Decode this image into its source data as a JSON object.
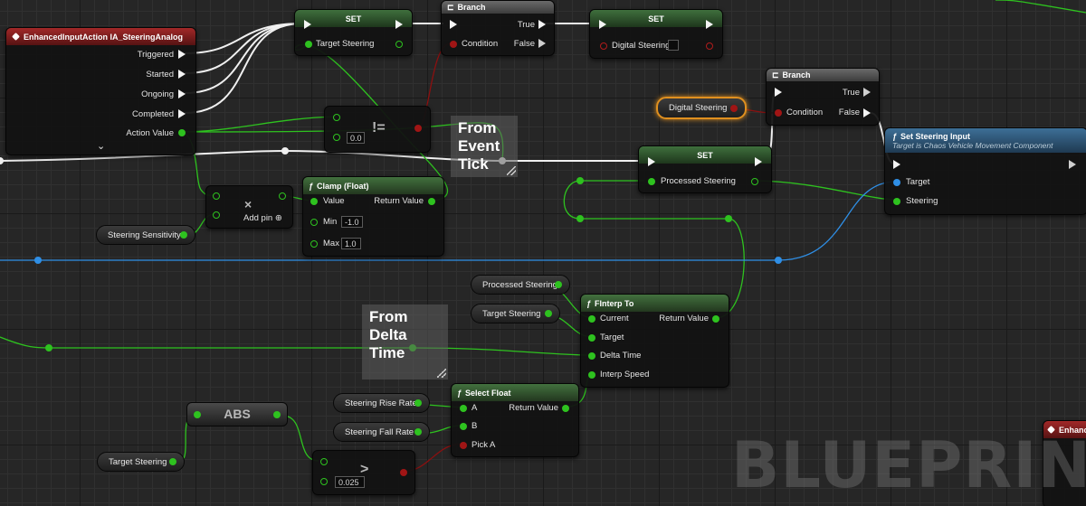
{
  "watermark": "BLUEPRINT",
  "nodes": {
    "input_action": {
      "title": "EnhancedInputAction IA_SteeringAnalog",
      "pins": [
        "Triggered",
        "Started",
        "Ongoing",
        "Completed",
        "Action Value"
      ],
      "expand": "⌄"
    },
    "input_action_offscreen": {
      "title": "Enhanc"
    },
    "set_target": {
      "title": "SET",
      "pin": "Target Steering"
    },
    "branch1": {
      "title": "Branch",
      "true_label": "True",
      "false_label": "False",
      "condition_label": "Condition"
    },
    "set_digital": {
      "title": "SET",
      "pin": "Digital Steering"
    },
    "branch2": {
      "title": "Branch",
      "true_label": "True",
      "false_label": "False",
      "condition_label": "Condition"
    },
    "digital_steering_var": {
      "label": "Digital Steering"
    },
    "not_equal": {
      "value": "0.0",
      "op": "!="
    },
    "set_steering_input": {
      "title": "Set Steering Input",
      "subtitle": "Target is Chaos Vehicle Movement Component",
      "target_label": "Target",
      "steering_label": "Steering"
    },
    "set_processed": {
      "title": "SET",
      "pin": "Processed Steering"
    },
    "multiply": {
      "op": "×",
      "add_pin": "Add pin"
    },
    "clamp": {
      "title": "Clamp (Float)",
      "value_label": "Value",
      "return_label": "Return Value",
      "min_label": "Min",
      "min_value": "-1.0",
      "max_label": "Max",
      "max_value": "1.0"
    },
    "steering_sensitivity": {
      "label": "Steering Sensitivity"
    },
    "processed_steering_var": {
      "label": "Processed Steering"
    },
    "target_steering_var": {
      "label": "Target Steering"
    },
    "finterp": {
      "title": "FInterp To",
      "current_label": "Current",
      "target_label": "Target",
      "delta_label": "Delta Time",
      "speed_label": "Interp Speed",
      "return_label": "Return Value"
    },
    "select_float": {
      "title": "Select Float",
      "a_label": "A",
      "b_label": "B",
      "pick_label": "Pick A",
      "return_label": "Return Value"
    },
    "rise_rate": {
      "label": "Steering Rise Rate"
    },
    "fall_rate": {
      "label": "Steering Fall Rate"
    },
    "abs": {
      "label": "ABS"
    },
    "target_steering_var2": {
      "label": "Target Steering"
    },
    "greater": {
      "value": "0.025",
      "op": ">"
    }
  },
  "comments": {
    "event_tick": "From Event Tick",
    "delta_time": "From Delta Time"
  },
  "colors": {
    "exec_wire": "#f0f0f0",
    "float_wire": "#2ec21f",
    "bool_wire": "#8c1010",
    "object_wire": "#2f8fe6",
    "function_header": "#3a6a37",
    "event_header": "#a22828",
    "selection": "#e0901f"
  }
}
